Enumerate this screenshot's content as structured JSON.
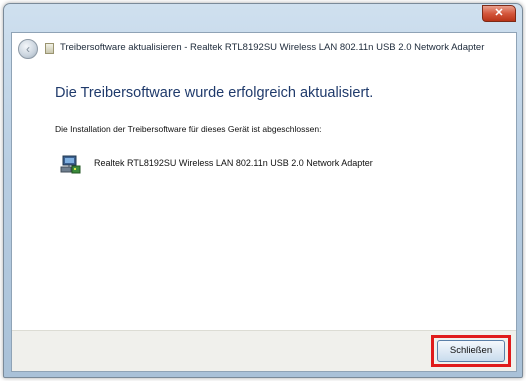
{
  "window": {
    "title": "Treibersoftware aktualisieren - Realtek RTL8192SU Wireless LAN 802.11n USB 2.0 Network Adapter",
    "close_symbol": "✕"
  },
  "nav": {
    "back_icon": "back-arrow-icon",
    "back_symbol": "‹"
  },
  "content": {
    "heading": "Die Treibersoftware wurde erfolgreich aktualisiert.",
    "description": "Die Installation der Treibersoftware für dieses Gerät ist abgeschlossen:",
    "device_icon": "network-adapter-icon",
    "device_name": "Realtek RTL8192SU Wireless LAN 802.11n USB 2.0 Network Adapter"
  },
  "footer": {
    "close_label": "Schließen"
  },
  "colors": {
    "heading": "#1f3a6b",
    "highlight": "#e01b1b",
    "close_button": "#d4573c"
  }
}
